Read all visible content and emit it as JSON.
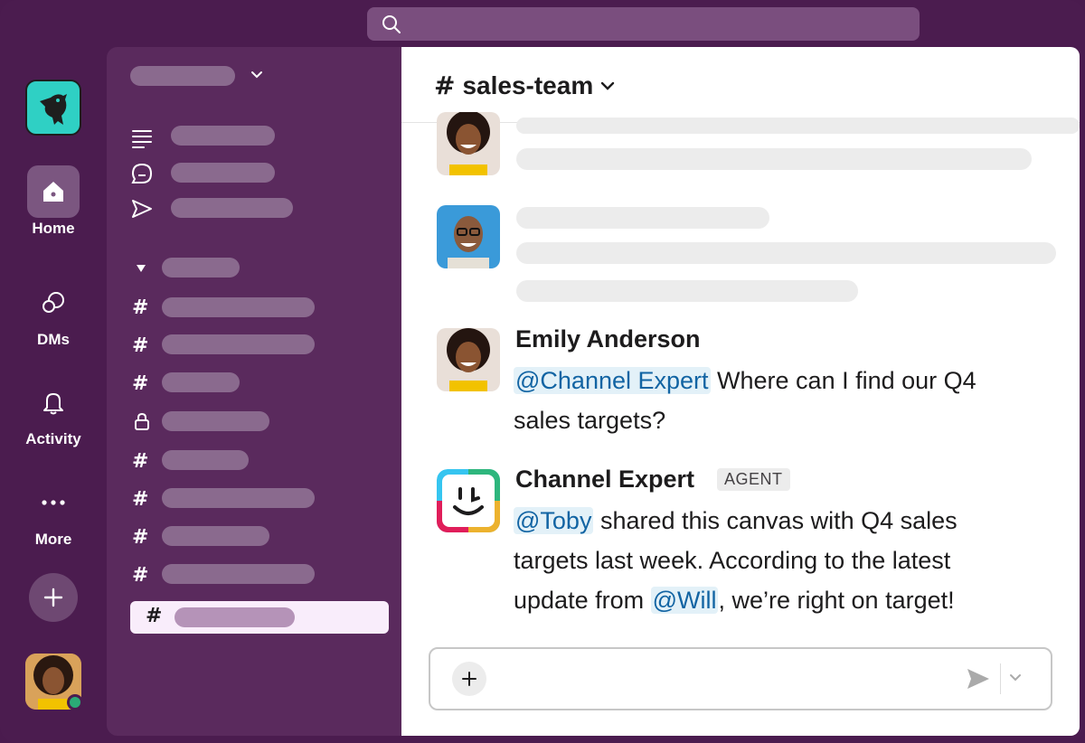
{
  "search": {
    "placeholder": ""
  },
  "rail": {
    "items": [
      {
        "label": "Home",
        "icon": "home-icon"
      },
      {
        "label": "DMs",
        "icon": "dms-icon"
      },
      {
        "label": "Activity",
        "icon": "bell-icon"
      },
      {
        "label": "More",
        "icon": "more-icon"
      }
    ]
  },
  "channel": {
    "title": "sales-team"
  },
  "messages": [
    {
      "author": "Emily Anderson",
      "text_mention": "@Channel Expert",
      "text": " Where can I find our Q4 sales targets?"
    },
    {
      "author": "Channel Expert",
      "badge": "AGENT",
      "mention1": "@Toby",
      "text1": " shared this canvas with Q4 sales targets last week. According to the latest update from ",
      "mention2": "@Will",
      "text2": ", we’re right on target!"
    }
  ],
  "colors": {
    "accent": "#4b1c4f",
    "sidebar": "#5a2a5d",
    "mention_bg": "#e3f1f8",
    "mention_text": "#1264a3",
    "presence": "#2bac76"
  }
}
